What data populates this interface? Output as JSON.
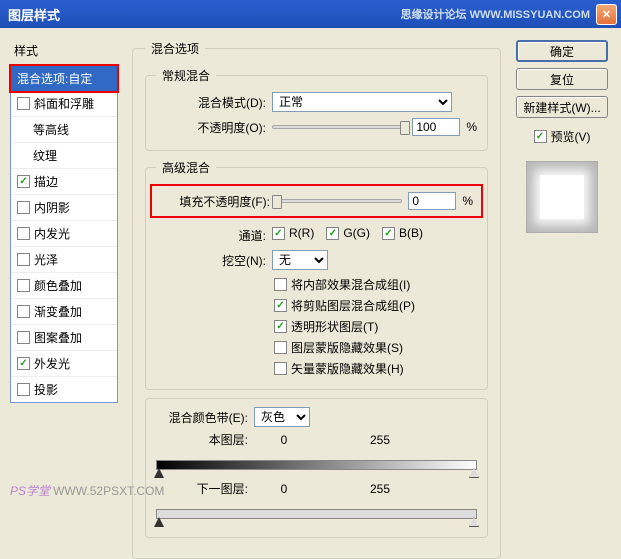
{
  "titlebar": {
    "title": "图层样式",
    "watermark": "思缘设计论坛  WWW.MISSYUAN.COM"
  },
  "sidebar": {
    "header": "样式",
    "items": [
      {
        "label": "混合选项:自定",
        "active": true,
        "highlight": true
      },
      {
        "label": "斜面和浮雕",
        "checked": false
      },
      {
        "label": "等高线",
        "indent": true
      },
      {
        "label": "纹理",
        "indent": true
      },
      {
        "label": "描边",
        "checked": true
      },
      {
        "label": "内阴影",
        "checked": false
      },
      {
        "label": "内发光",
        "checked": false
      },
      {
        "label": "光泽",
        "checked": false
      },
      {
        "label": "颜色叠加",
        "checked": false
      },
      {
        "label": "渐变叠加",
        "checked": false
      },
      {
        "label": "图案叠加",
        "checked": false
      },
      {
        "label": "外发光",
        "checked": true
      },
      {
        "label": "投影",
        "checked": false
      }
    ]
  },
  "main": {
    "fieldset_title": "混合选项",
    "general": {
      "title": "常规混合",
      "blend_mode_label": "混合模式(D):",
      "blend_mode_value": "正常",
      "opacity_label": "不透明度(O):",
      "opacity_value": "100",
      "opacity_unit": "%"
    },
    "advanced": {
      "title": "高级混合",
      "fill_opacity_label": "填充不透明度(F):",
      "fill_opacity_value": "0",
      "fill_opacity_unit": "%",
      "channels_label": "通道:",
      "channels": [
        {
          "label": "R(R)",
          "checked": true
        },
        {
          "label": "G(G)",
          "checked": true
        },
        {
          "label": "B(B)",
          "checked": true
        }
      ],
      "knockout_label": "挖空(N):",
      "knockout_value": "无",
      "checkboxes": [
        {
          "label": "将内部效果混合成组(I)",
          "checked": false
        },
        {
          "label": "将剪贴图层混合成组(P)",
          "checked": true
        },
        {
          "label": "透明形状图层(T)",
          "checked": true
        },
        {
          "label": "图层蒙版隐藏效果(S)",
          "checked": false
        },
        {
          "label": "矢量蒙版隐藏效果(H)",
          "checked": false
        }
      ]
    },
    "blend_if": {
      "label": "混合颜色带(E):",
      "value": "灰色",
      "this_layer_label": "本图层:",
      "this_min": "0",
      "this_max": "255",
      "under_layer_label": "下一图层:",
      "under_min": "0",
      "under_max": "255"
    }
  },
  "buttons": {
    "ok": "确定",
    "cancel": "复位",
    "new_style": "新建样式(W)...",
    "preview_label": "预览(V)",
    "preview_checked": true
  },
  "watermark": {
    "brand": "PS学堂",
    "url": "WWW.52PSXT.COM"
  }
}
